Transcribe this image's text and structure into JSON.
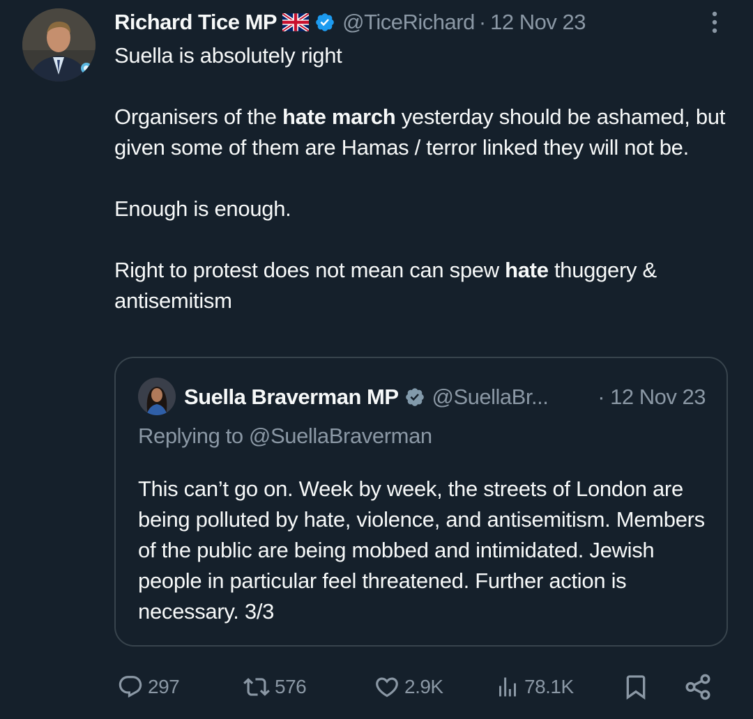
{
  "tweet": {
    "author_name": "Richard Tice MP",
    "author_flag_icon": "uk-flag-icon",
    "handle": "@TiceRichard",
    "separator": "·",
    "date": "12 Nov 23",
    "text": {
      "line1": "Suella is absolutely right",
      "p2_a": "Organisers of the ",
      "p2_bold": "hate march",
      "p2_b": " yesterday should be ashamed, but given some of them are Hamas / terror linked they will not be.",
      "p3": "Enough is enough.",
      "p4_a": "Right to protest does not mean can spew ",
      "p4_bold": "hate",
      "p4_b": " thuggery & antisemitism"
    }
  },
  "quoted_tweet": {
    "author_name": "Suella Braverman MP",
    "handle": "@SuellaBr...",
    "date": "· 12 Nov 23",
    "replying_to": "Replying to @SuellaBraverman",
    "text": "This can’t go on. Week by week, the streets of London are being polluted by hate, violence, and antisemitism. Members of the public are being mobbed and intimidated. Jewish people in particular feel threatened. Further action is necessary. 3/3"
  },
  "actions": {
    "replies": "297",
    "reposts": "576",
    "likes": "2.9K",
    "views": "78.1K"
  },
  "colors": {
    "background": "#15202b",
    "text_primary": "#f7f9f9",
    "text_secondary": "#8b98a5",
    "verified_blue": "#1d9bf0",
    "verified_gray": "#829aab",
    "border": "#38444d"
  }
}
